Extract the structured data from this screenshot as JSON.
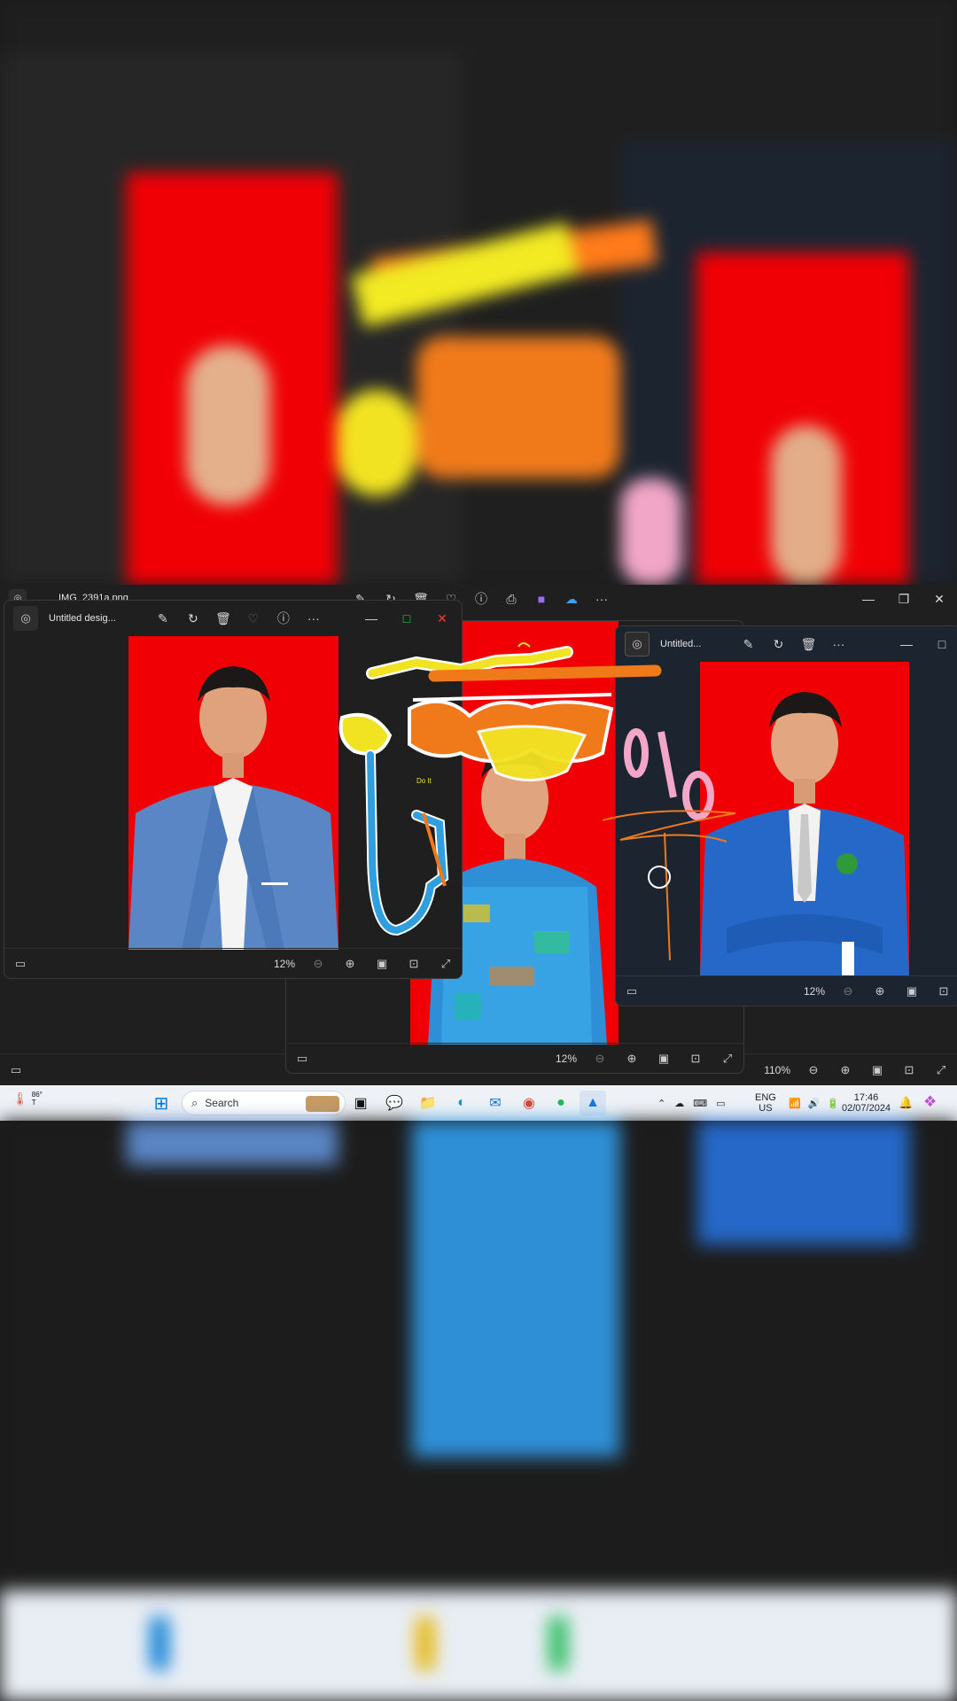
{
  "windows": {
    "back": {
      "title": "IMG_2391a.png",
      "zoom": "110%"
    },
    "left": {
      "title": "Untitled desig...",
      "zoom": "12%"
    },
    "middle": {
      "zoom": "12%",
      "doodle_text": "Do It"
    },
    "right": {
      "title": "Untitled...",
      "zoom": "12%"
    }
  },
  "taskbar": {
    "weather_temp": "86°",
    "weather_sub": "T",
    "search_placeholder": "Search",
    "lang_top": "ENG",
    "lang_bottom": "US",
    "time": "17:46",
    "date": "02/07/2024"
  },
  "icons": {
    "edit": "edit-image-icon",
    "rotate": "rotate-icon",
    "delete": "trash-icon",
    "favorite": "heart-icon",
    "info": "info-icon",
    "more": "more-icon",
    "print": "print-icon",
    "onedrive": "cloud-icon"
  },
  "colors": {
    "photo_bg": "#f00005",
    "taskbar_bg": "#eef2f7",
    "window_bg": "#202020"
  }
}
